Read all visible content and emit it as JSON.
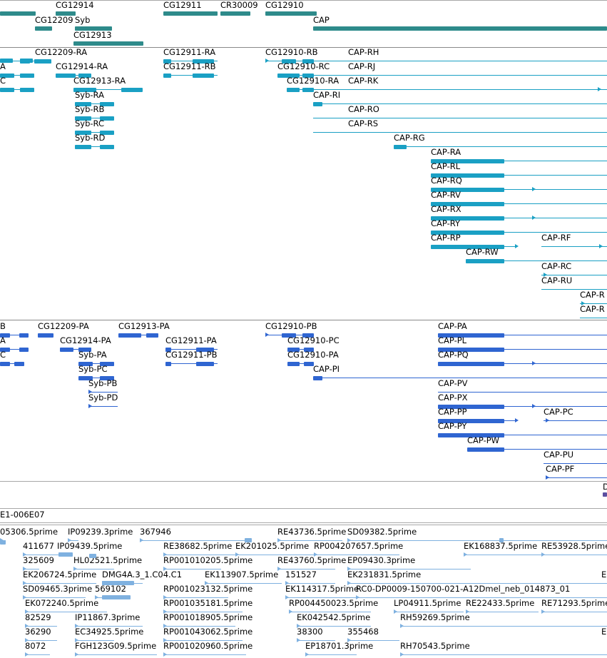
{
  "colors": {
    "gene_track": "#2e8b8b",
    "transcript_track": "#1aa0c4",
    "protein_track": "#2f65d1",
    "est_track": "#7fb1e0",
    "small_track": "#5b4fa0",
    "separator": "#a8a8a8"
  },
  "tracks": {
    "gene": {
      "labels": [
        "CG12914",
        "CG12911",
        "CR30009",
        "CG12910",
        "CG12209",
        "Syb",
        "CAP",
        "CG12913"
      ]
    },
    "transcript": {
      "labels": [
        "A",
        "C",
        "CG12209-RA",
        "CG12914-RA",
        "CG12913-RA",
        "Syb-RA",
        "Syb-RB",
        "Syb-RC",
        "Syb-RD",
        "CG12911-RA",
        "CG12911-RB",
        "CG12910-RB",
        "CG12910-RC",
        "CG12910-RA",
        "CAP-RH",
        "CAP-RJ",
        "CAP-RK",
        "CAP-RI",
        "CAP-RO",
        "CAP-RS",
        "CAP-RG",
        "CAP-RA",
        "CAP-RL",
        "CAP-RQ",
        "CAP-RV",
        "CAP-RX",
        "CAP-RY",
        "CAP-RP",
        "CAP-RF",
        "CAP-RW",
        "CAP-RC",
        "CAP-RU",
        "CAP-R",
        "CAP-R"
      ]
    },
    "protein": {
      "labels": [
        "B",
        "A",
        "C",
        "CG12209-PA",
        "CG12913-PA",
        "CG12914-PA",
        "Syb-PA",
        "Syb-PC",
        "Syb-PB",
        "Syb-PD",
        "CG12911-PA",
        "CG12911-PB",
        "CG12910-PB",
        "CG12910-PC",
        "CG12910-PA",
        "CAP-PI",
        "CAP-PA",
        "CAP-PL",
        "CAP-PQ",
        "CAP-PV",
        "CAP-PX",
        "CAP-PP",
        "CAP-PC",
        "CAP-PY",
        "CAP-PW",
        "CAP-PU",
        "CAP-PF"
      ]
    },
    "small": {
      "labels": [
        "D"
      ]
    },
    "insertion": {
      "labels": [
        "E1-006E07"
      ]
    },
    "est": {
      "labels": [
        "05306.5prime",
        "IP09239.3prime",
        "367946",
        "RE43736.5prime",
        "SD09382.5prime",
        "411677",
        "IP09439.5prime",
        "RE38682.5prime",
        "EK201025.5prime",
        "RP004207657.5prime",
        "EK168837.5prime",
        "RE53928.5prime",
        "325609",
        "HL02521.5prime",
        "RP001010205.5prime",
        "RE43760.5prime",
        "EP09430.3prime",
        "EK206724.5prime",
        "DMG4A.3_1.C04.C1",
        "EK113907.5prime",
        "151527",
        "EK231831.5prime",
        "E",
        "SD09465.3prime",
        "569102",
        "RP001023132.5prime",
        "EK114317.5prime",
        "RC0-DP0009-150700-021-A12Dmel_neb_014873_01",
        "EK072240.5prime",
        "RP001035181.5prime",
        "RP004450023.5prime",
        "LP04911.5prime",
        "RE22433.5prime",
        "RE71293.5prime",
        "82529",
        "IP11867.3prime",
        "RP001018905.5prime",
        "EK042542.5prime",
        "RH59269.5prime",
        "36290",
        "EC34925.5prime",
        "RP001043062.5prime",
        "38300",
        "355468",
        "El",
        "8072",
        "FGH123G09.5prime",
        "RP001020960.5prime",
        "EP18701.3prime",
        "RH70543.5prime"
      ]
    }
  }
}
